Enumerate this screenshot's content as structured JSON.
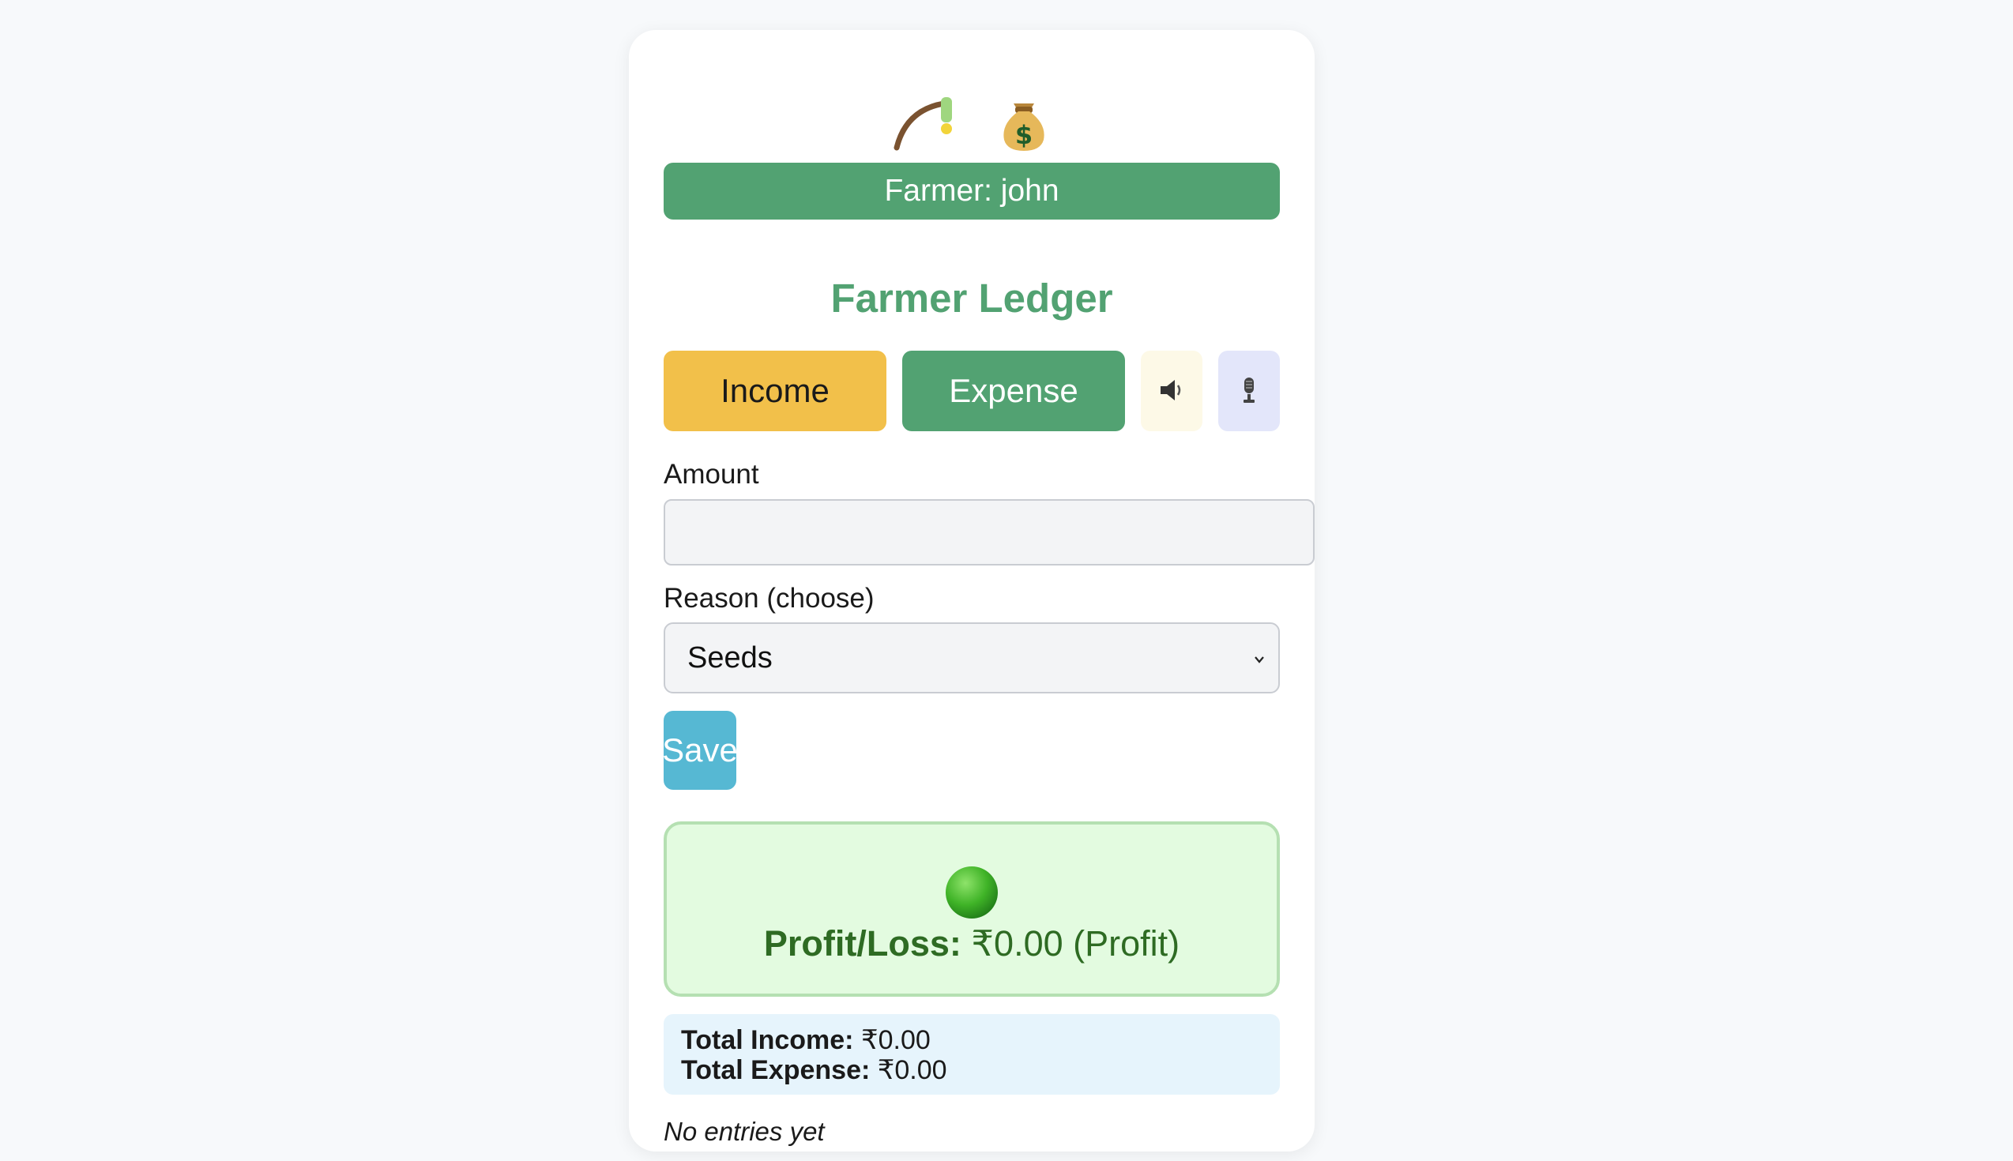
{
  "header": {
    "logo_icons": [
      "plant-sprout-icon",
      "money-bag-icon"
    ],
    "farmer_label": "Farmer: john",
    "title": "Farmer Ledger"
  },
  "actions": {
    "income_label": "Income",
    "expense_label": "Expense",
    "speaker_icon": "speaker-icon",
    "mic_icon": "microphone-icon"
  },
  "form": {
    "amount_label": "Amount",
    "amount_value": "",
    "reason_label": "Reason (choose)",
    "reason_selected": "Seeds",
    "save_label": "Save"
  },
  "summary": {
    "status_icon": "green-circle-icon",
    "status_color": "#2e6b23",
    "profit_loss_label": "Profit/Loss:",
    "profit_loss_value": "₹0.00 (Profit)",
    "total_income_label": "Total Income:",
    "total_income_value": "₹0.00",
    "total_expense_label": "Total Expense:",
    "total_expense_value": "₹0.00"
  },
  "entries": {
    "empty_text": "No entries yet"
  },
  "colors": {
    "primary": "#52a272",
    "income": "#f2c04a",
    "save": "#56b8d3"
  }
}
